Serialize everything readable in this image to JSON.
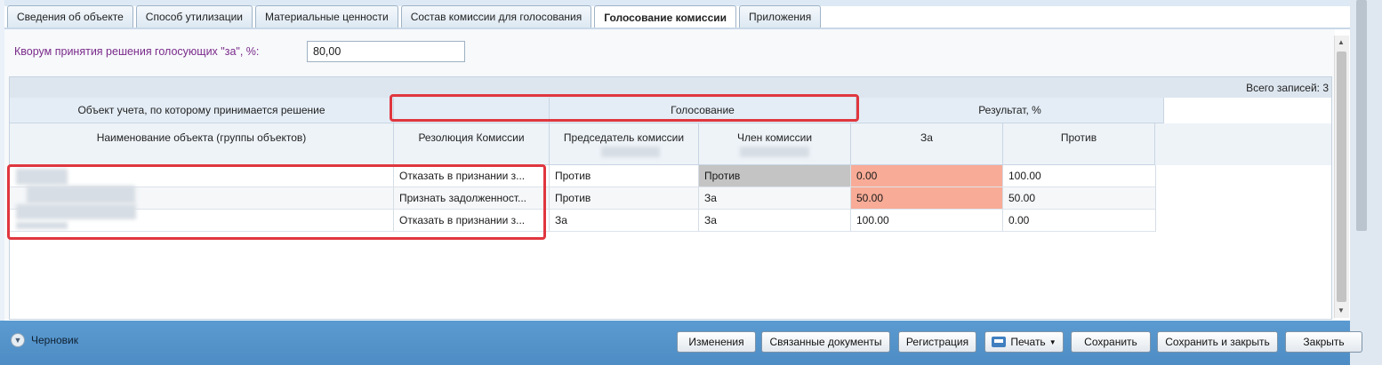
{
  "tabs": [
    {
      "label": "Сведения об объекте",
      "active": false
    },
    {
      "label": "Способ утилизации",
      "active": false
    },
    {
      "label": "Материальные ценности",
      "active": false
    },
    {
      "label": "Состав комиссии для голосования",
      "active": false
    },
    {
      "label": "Голосование комиссии",
      "active": true
    },
    {
      "label": "Приложения",
      "active": false
    }
  ],
  "quorum": {
    "label": "Кворум принятия решения голосующих \"за\", %:",
    "value": "80,00"
  },
  "grid": {
    "total": "Всего записей: 3",
    "group_headers": {
      "object": "Объект учета, по которому принимается решение",
      "voting": "Голосование",
      "result": "Результат, %"
    },
    "columns": {
      "name": "Наименование объекта (группы объектов)",
      "resolution": "Резолюция Комиссии",
      "chairman": "Председатель комиссии",
      "member": "Член комиссии",
      "for": "За",
      "against": "Против"
    },
    "rows": [
      {
        "resolution": "Отказать в признании з...",
        "chairman": "Против",
        "member": "Против",
        "for": "0.00",
        "against": "100.00"
      },
      {
        "resolution": "Признать задолженност...",
        "chairman": "Против",
        "member": "За",
        "for": "50.00",
        "against": "50.00"
      },
      {
        "resolution": "Отказать в признании з...",
        "chairman": "За",
        "member": "За",
        "for": "100.00",
        "against": "0.00"
      }
    ]
  },
  "colors": {
    "highlight_for": "#f8ab96",
    "highlight_member": "#c4c4c4",
    "annotation_red": "#e0363f"
  },
  "footer": {
    "status": "Черновик",
    "buttons": {
      "changes": "Изменения",
      "related": "Связанные документы",
      "registration": "Регистрация",
      "print": "Печать",
      "save": "Сохранить",
      "save_close": "Сохранить и закрыть",
      "close": "Закрыть"
    }
  }
}
